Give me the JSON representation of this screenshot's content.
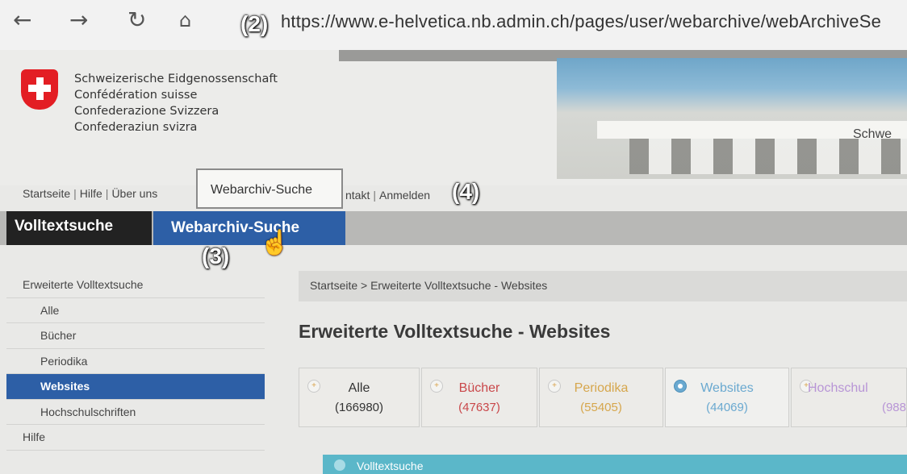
{
  "browser": {
    "back_icon": "←",
    "forward_icon": "→",
    "reload_icon": "↻",
    "home_icon": "⌂",
    "url": "https://www.e-helvetica.nb.admin.ch/pages/user/webarchive/webArchiveSe"
  },
  "markers": {
    "m2": "(2)",
    "m3": "(3)",
    "m4": "(4)"
  },
  "header": {
    "confederation": [
      "Schweizerische Eidgenossenschaft",
      "Confédération suisse",
      "Confederazione Svizzera",
      "Confederaziun svizra"
    ],
    "banner_text": "Schwe"
  },
  "meta_nav": {
    "startseite": "Startseite",
    "sep": "|",
    "hilfe": "Hilfe",
    "ueber": "Über uns",
    "kontakt": "ntakt",
    "anmelden": "Anmelden"
  },
  "tooltip": "Webarchiv-Suche",
  "tabs": {
    "fulltext": "Volltextsuche",
    "webarchive": "Webarchiv-Suche"
  },
  "sidebar": {
    "items": [
      {
        "label": "Erweiterte Volltextsuche"
      },
      {
        "label": "Alle"
      },
      {
        "label": "Bücher"
      },
      {
        "label": "Periodika"
      },
      {
        "label": "Websites"
      },
      {
        "label": "Hochschulschriften"
      },
      {
        "label": "Hilfe"
      }
    ]
  },
  "breadcrumb": "Startseite  >  Erweiterte Volltextsuche - Websites",
  "page_title": "Erweiterte Volltextsuche - Websites",
  "categories": [
    {
      "label": "Alle",
      "count": "(166980)",
      "color": "#333333"
    },
    {
      "label": "Bücher",
      "count": "(47637)",
      "color": "#c9474a"
    },
    {
      "label": "Periodika",
      "count": "(55405)",
      "color": "#d6a64c"
    },
    {
      "label": "Websites",
      "count": "(44069)",
      "color": "#6aa9d0"
    },
    {
      "label": "Hochschul",
      "count": "(988",
      "color": "#b895d6"
    }
  ],
  "bottom_box": "Volltextsuche",
  "cursor_icon": "☝"
}
